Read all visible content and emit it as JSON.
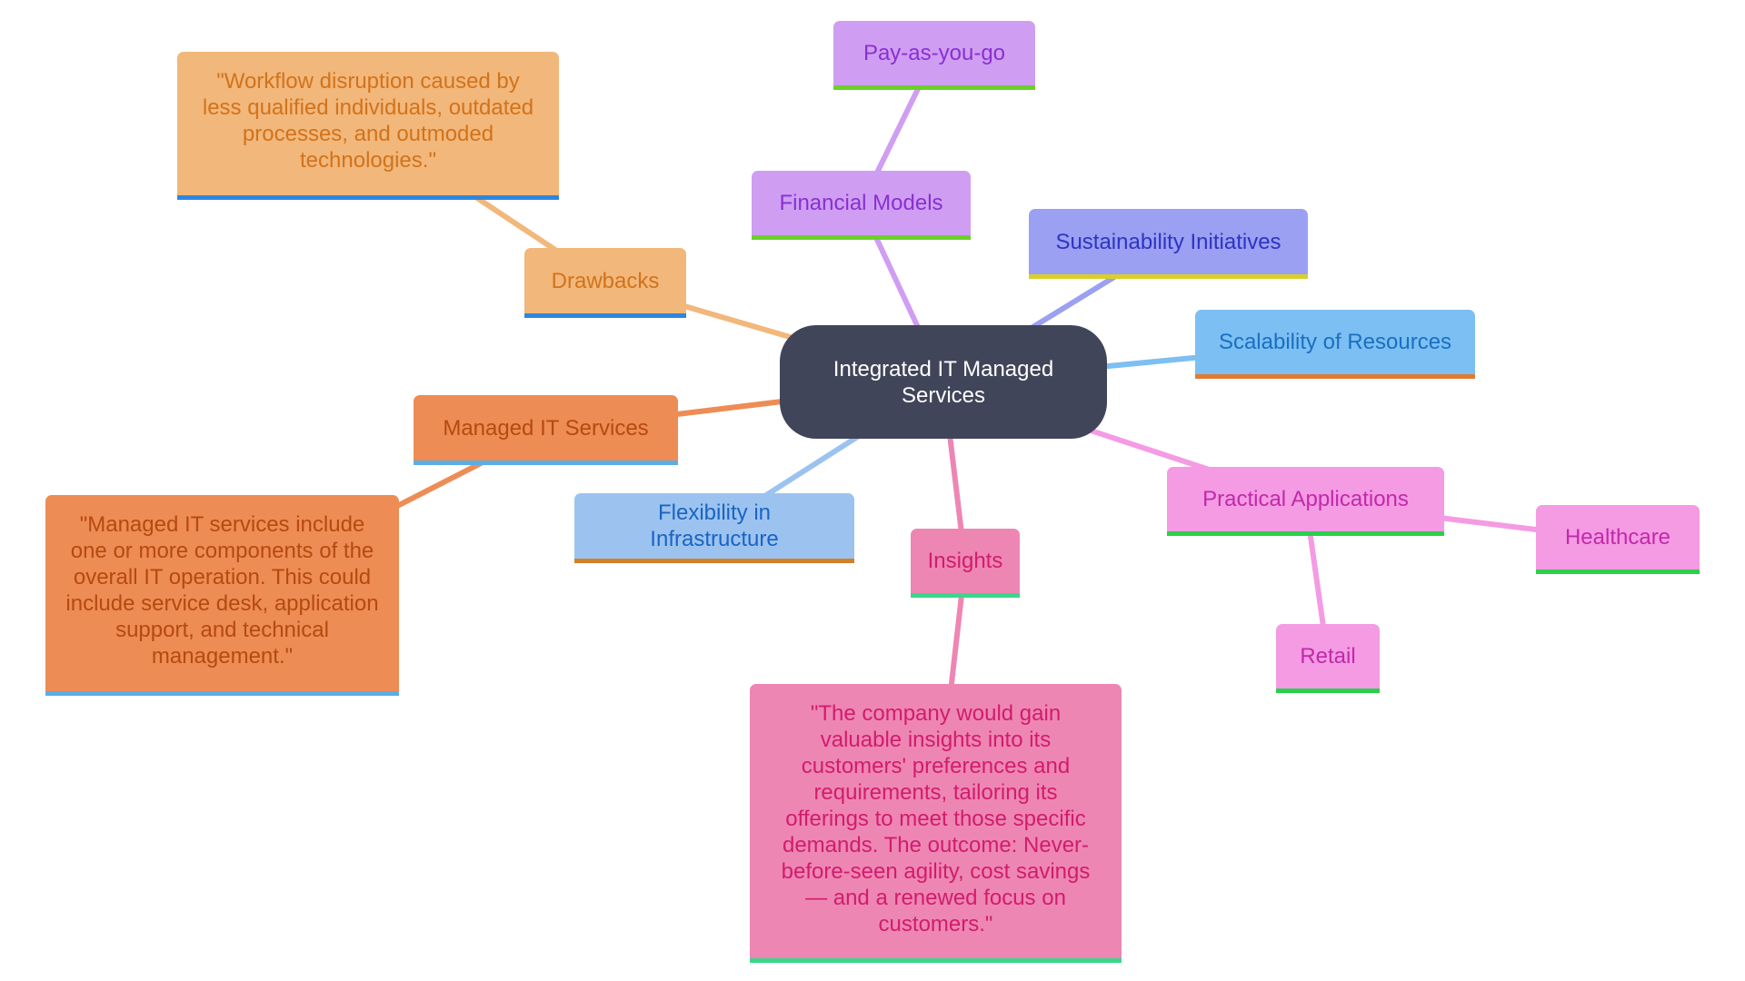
{
  "diagram": {
    "type": "mindmap",
    "root": {
      "id": "root",
      "label": "Integrated IT Managed Services",
      "bg": "#414559",
      "text": "#ffffff"
    },
    "nodes": [
      {
        "id": "drawbacks",
        "parent": "root",
        "label": "Drawbacks",
        "bg": "#f2b77b",
        "text": "#d1731b",
        "accent": "#2f86de",
        "edge": "#f2b77b"
      },
      {
        "id": "drawbacks-quote",
        "parent": "drawbacks",
        "label": "\"Workflow disruption caused by less qualified individuals, outdated processes, and outmoded technologies.\"",
        "bg": "#f2b77b",
        "text": "#d1731b",
        "accent": "#2f86de",
        "edge": "#f2b77b"
      },
      {
        "id": "financial-models",
        "parent": "root",
        "label": "Financial Models",
        "bg": "#cf9ef2",
        "text": "#8a2fd1",
        "accent": "#6ccf2a",
        "edge": "#cf9ef2"
      },
      {
        "id": "pay-as-you-go",
        "parent": "financial-models",
        "label": "Pay-as-you-go",
        "bg": "#cf9ef2",
        "text": "#8a2fd1",
        "accent": "#6ccf2a",
        "edge": "#cf9ef2"
      },
      {
        "id": "sustainability",
        "parent": "root",
        "label": "Sustainability Initiatives",
        "bg": "#9ba0f2",
        "text": "#2f33c2",
        "accent": "#d9cf2a",
        "edge": "#9ba0f2"
      },
      {
        "id": "scalability",
        "parent": "root",
        "label": "Scalability of Resources",
        "bg": "#7cbff2",
        "text": "#1a6fc2",
        "accent": "#e07b34",
        "edge": "#7cbff2"
      },
      {
        "id": "managed-it",
        "parent": "root",
        "label": "Managed IT Services",
        "bg": "#ee8c55",
        "text": "#b54a10",
        "accent": "#5aaee6",
        "edge": "#ee8c55"
      },
      {
        "id": "managed-it-quote",
        "parent": "managed-it",
        "label": "\"Managed IT services include one or more components of the overall IT operation. This could include service desk, application support, and technical management.\"",
        "bg": "#ee8c55",
        "text": "#b54a10",
        "accent": "#5aaee6",
        "edge": "#ee8c55"
      },
      {
        "id": "flexibility",
        "parent": "root",
        "label": "Flexibility in Infrastructure",
        "bg": "#9cc3f0",
        "text": "#1a64c2",
        "accent": "#d27f2a",
        "edge": "#9cc3f0"
      },
      {
        "id": "insights",
        "parent": "root",
        "label": "Insights",
        "bg": "#ee86b4",
        "text": "#d11c6c",
        "accent": "#3ad68a",
        "edge": "#ee86b4"
      },
      {
        "id": "insights-quote",
        "parent": "insights",
        "label": "\"The company would gain valuable insights into its customers' preferences and requirements, tailoring its offerings to meet those specific demands. The outcome: Never-before-seen agility, cost savings — and a renewed focus on customers.\"",
        "bg": "#ee86b4",
        "text": "#d11c6c",
        "accent": "#3ad68a",
        "edge": "#ee86b4"
      },
      {
        "id": "practical",
        "parent": "root",
        "label": "Practical Applications",
        "bg": "#f49be4",
        "text": "#c229a8",
        "accent": "#2ad04a",
        "edge": "#f49be4"
      },
      {
        "id": "healthcare",
        "parent": "practical",
        "label": "Healthcare",
        "bg": "#f49be4",
        "text": "#c229a8",
        "accent": "#2ad04a",
        "edge": "#f49be4"
      },
      {
        "id": "retail",
        "parent": "practical",
        "label": "Retail",
        "bg": "#f49be4",
        "text": "#c229a8",
        "accent": "#2ad04a",
        "edge": "#f49be4"
      }
    ]
  }
}
